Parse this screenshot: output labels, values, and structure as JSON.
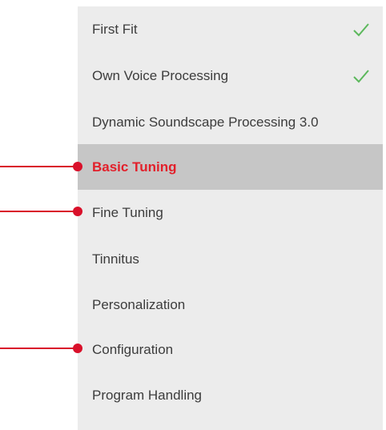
{
  "menu": {
    "items": [
      {
        "label": "First Fit",
        "checked": true,
        "active": false,
        "icon": "check-icon"
      },
      {
        "label": "Own Voice Processing",
        "checked": true,
        "active": false,
        "icon": "check-icon"
      },
      {
        "label": "Dynamic Soundscape Processing 3.0",
        "checked": false,
        "active": false
      },
      {
        "label": "Basic Tuning",
        "checked": false,
        "active": true
      },
      {
        "label": "Fine Tuning",
        "checked": false,
        "active": false
      },
      {
        "label": "Tinnitus",
        "checked": false,
        "active": false
      },
      {
        "label": "Personalization",
        "checked": false,
        "active": false
      },
      {
        "label": "Configuration",
        "checked": false,
        "active": false
      },
      {
        "label": "Program Handling",
        "checked": false,
        "active": false
      }
    ]
  },
  "callouts": [
    "Basic Tuning",
    "Fine Tuning",
    "Configuration"
  ],
  "colors": {
    "panel_background": "#ececec",
    "active_background": "#c6c6c6",
    "active_text": "#e2202b",
    "check": "#5cb85c",
    "callout": "#d9102a"
  }
}
